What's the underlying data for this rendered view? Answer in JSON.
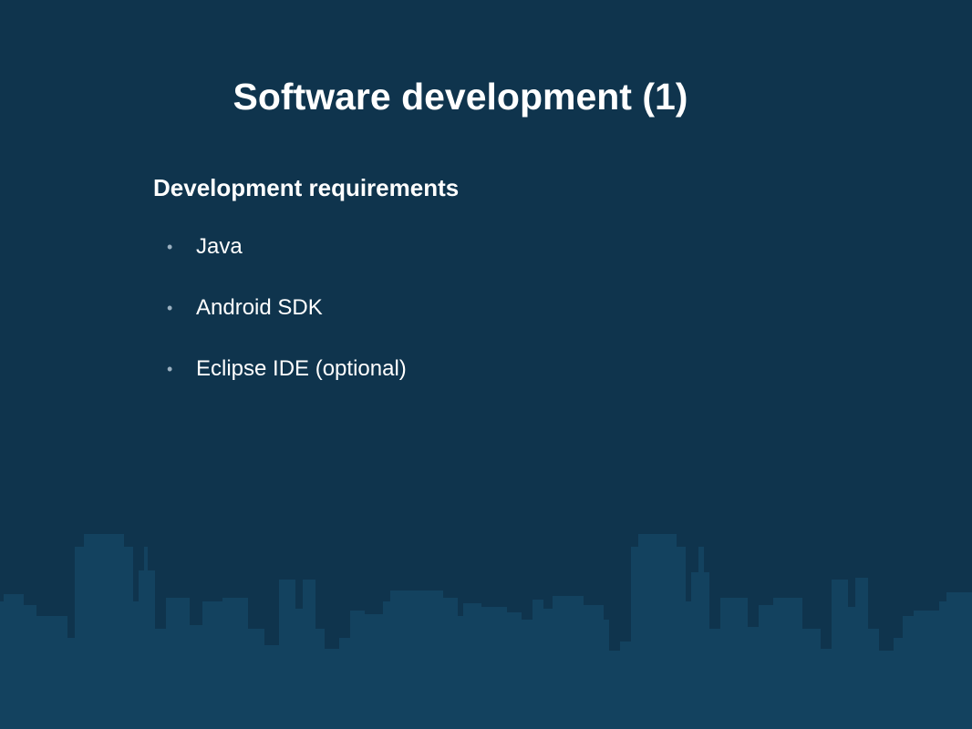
{
  "slide": {
    "title": "Software development (1)",
    "subtitle": "Development requirements",
    "bullets": [
      "Java",
      "Android SDK",
      "Eclipse IDE (optional)"
    ]
  },
  "colors": {
    "background": "#0f344d",
    "skyline": "#13425f",
    "text": "#ffffff",
    "bullet_marker": "#9bb0c0"
  },
  "decoration": {
    "skyline_icon": "city-skyline-icon"
  }
}
